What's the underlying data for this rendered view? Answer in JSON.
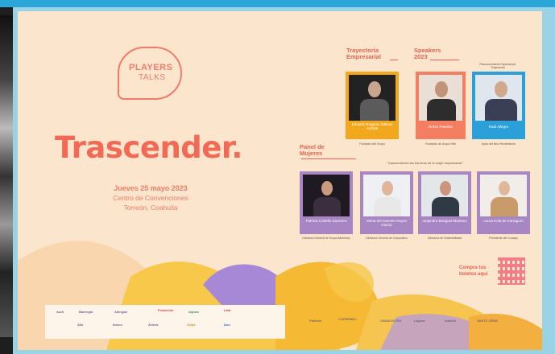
{
  "logo": {
    "line1": "PLAYERS",
    "line2": "TALKS"
  },
  "title": "Trascender.",
  "event": {
    "date": "Jueves 25 mayo 2023",
    "venue": "Centro de Convenciones",
    "city": "Torreón, Coahuila"
  },
  "sections": {
    "trayectoria": {
      "line1": "Trayectoria",
      "line2": "Empresarial"
    },
    "speakers": {
      "line1": "Speakers",
      "line2": "2023"
    },
    "panel": {
      "line1": "Panel de",
      "line2": "Mujeres"
    }
  },
  "notes": {
    "top_right": "Reconocimiento Especial por Trayectoria",
    "panel_quote": "“ Trascendiendo las barreras de la mujer empresarial ”"
  },
  "speakers_top": [
    {
      "name": "Eduardo Eugenio Salinas Antrida",
      "sub": "Fundador del Grupo",
      "color": "#f2a81d"
    },
    {
      "name": "Orden Paredes",
      "sub": "Fundador de Grupo Elite",
      "color": "#f37e62"
    },
    {
      "name": "Raúl Allegre",
      "sub": "Autor del libro Rendimiento",
      "color": "#2a9fd8"
    }
  ],
  "panelists": [
    {
      "name": "Patricia Cobello Guerrero",
      "sub": "Directora General de Grupo Alimentos"
    },
    {
      "name": "Maria del Carmen Reyes Garcia",
      "sub": "Directora General de Corporativo"
    },
    {
      "name": "Alejandra Benguet Martinez",
      "sub": "Directora de Sostenibilidad"
    },
    {
      "name": "Laura Kofa de Irarragorri",
      "sub": "Presidente del Consejo"
    }
  ],
  "cta": {
    "line1": "Compra tus",
    "line2": "boletos aquí"
  },
  "sponsors": [
    "Audi",
    "Banregio",
    "Allergan",
    "Proacción",
    "Coca-Cola",
    "Alpura",
    "Vega",
    "Inteco",
    "Arteca",
    "Alis",
    "Lala",
    "Valpa",
    "Duo"
  ],
  "organizers": [
    "Partners",
    "COPARMEX",
    "CANACINTRA",
    "Laguna",
    "Instituto",
    "SANTE ORBA"
  ],
  "colors": {
    "background": "#fbe6cd",
    "accent": "#f26a55",
    "panel_card": "#a886c4"
  }
}
